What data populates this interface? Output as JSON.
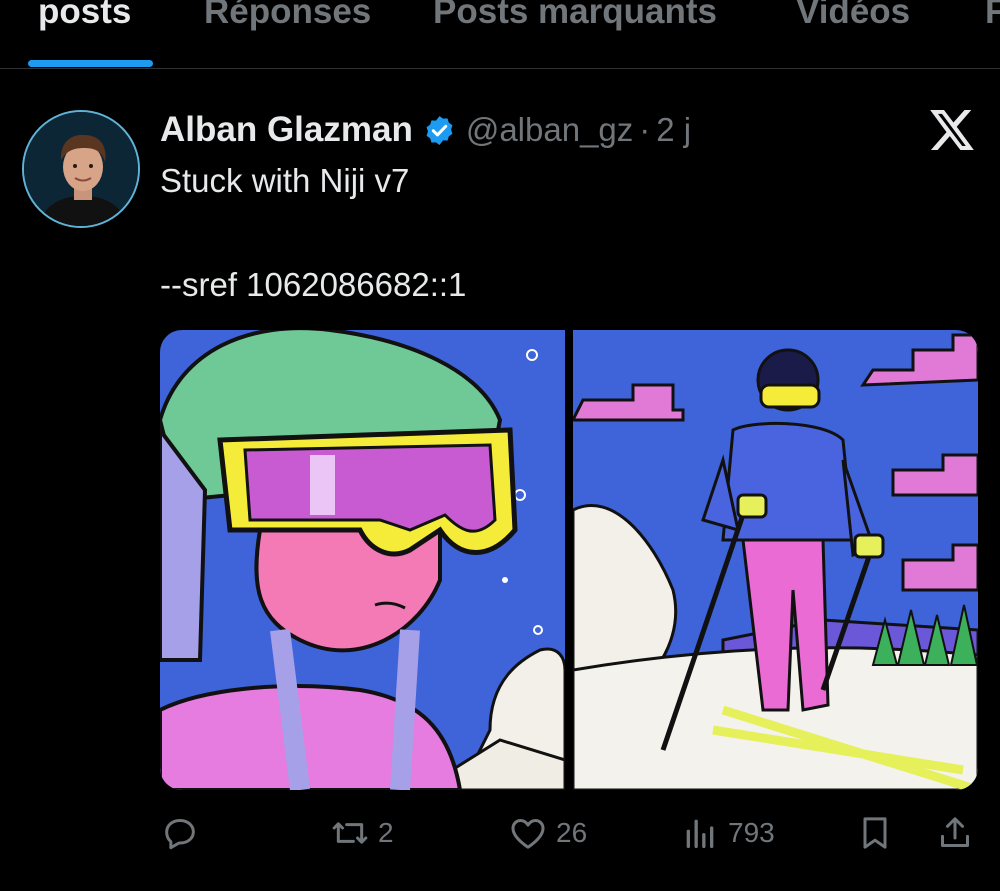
{
  "tabs": [
    "posts",
    "Réponses",
    "Posts marquants",
    "Vidéos",
    "F"
  ],
  "post": {
    "author_name": "Alban Glazman",
    "handle": "@alban_gz",
    "separator": "·",
    "time": "2 j",
    "text_line1": "Stuck with Niji v7",
    "text_line2": "--sref 1062086682::1"
  },
  "actions": {
    "retweets": "2",
    "likes": "26",
    "views": "793"
  },
  "colors": {
    "accent": "#1d9bf0",
    "muted": "#71767b",
    "text": "#e7e9ea",
    "background": "#000000"
  },
  "icons": [
    "verified-badge-icon",
    "x-logo-icon",
    "reply-icon",
    "retweet-icon",
    "like-icon",
    "views-icon",
    "bookmark-icon",
    "share-icon"
  ]
}
